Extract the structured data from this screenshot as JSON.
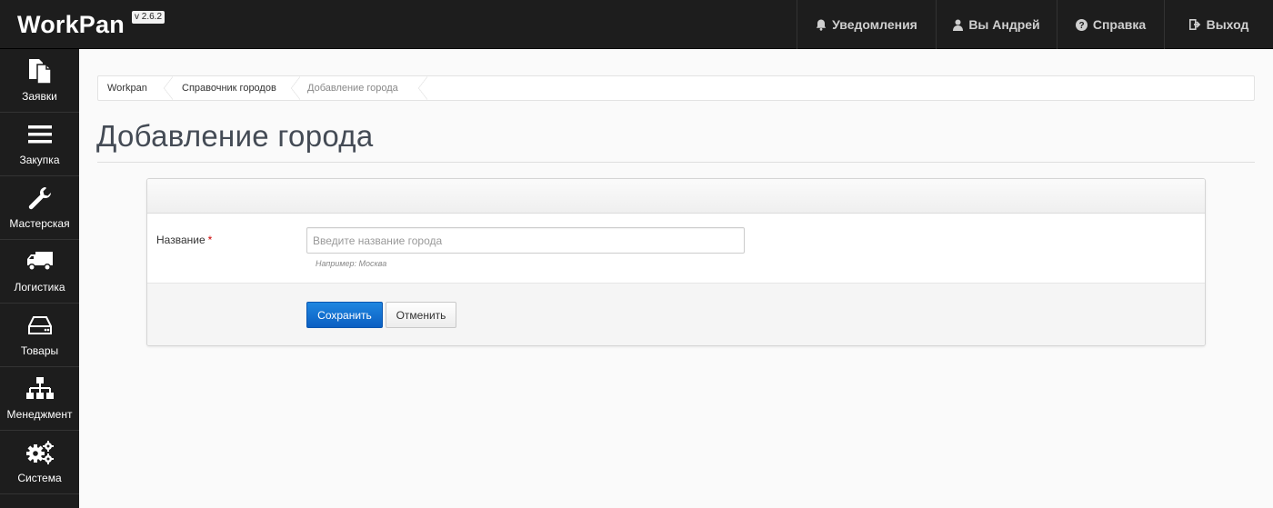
{
  "app": {
    "brand": "WorkPan",
    "version": "v 2.6.2"
  },
  "topnav": [
    {
      "id": "notifications",
      "label": "Уведомления",
      "icon": "bell-icon"
    },
    {
      "id": "user",
      "label": "Вы Андрей",
      "icon": "user-icon"
    },
    {
      "id": "help",
      "label": "Справка",
      "icon": "question-icon"
    },
    {
      "id": "logout",
      "label": "Выход",
      "icon": "logout-icon"
    }
  ],
  "sidebar": {
    "items": [
      {
        "label": "Заявки",
        "icon": "documents-icon"
      },
      {
        "label": "Закупка",
        "icon": "list-icon"
      },
      {
        "label": "Мастерская",
        "icon": "wrench-icon"
      },
      {
        "label": "Логистика",
        "icon": "truck-icon"
      },
      {
        "label": "Товары",
        "icon": "hdd-icon"
      },
      {
        "label": "Менеджмент",
        "icon": "sitemap-icon"
      },
      {
        "label": "Система",
        "icon": "gears-icon"
      }
    ]
  },
  "breadcrumb": [
    "Workpan",
    "Справочник городов",
    "Добавление города"
  ],
  "page": {
    "title": "Добавление города"
  },
  "form": {
    "name_label": "Название",
    "required_mark": "*",
    "name_value": "",
    "name_placeholder": "Введите название города",
    "name_help": "Например: Москва",
    "save_label": "Сохранить",
    "cancel_label": "Отменить"
  },
  "colors": {
    "topbar": "#1d1d1d",
    "primary": "#0b5fc2",
    "required": "#cc0000"
  }
}
